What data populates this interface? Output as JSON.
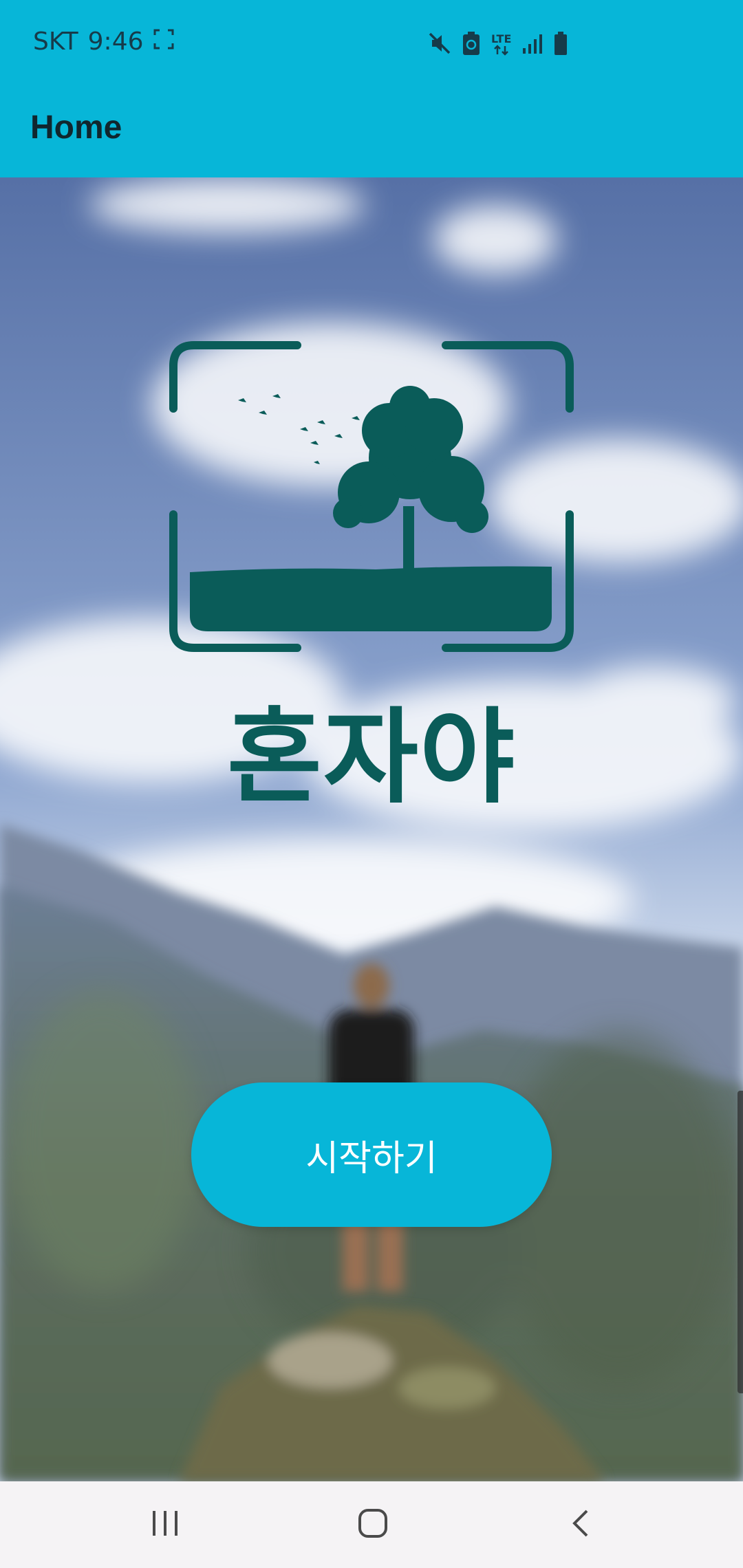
{
  "status_bar": {
    "carrier": "SKT",
    "time": "9:46",
    "network": "LTE",
    "icons": [
      "screenshot-frame-icon",
      "mute-icon",
      "battery-saver-icon",
      "lte-data-icon",
      "signal-icon",
      "battery-icon"
    ]
  },
  "app_bar": {
    "title": "Home"
  },
  "logo": {
    "text": "혼자야",
    "color": "#0a5c59"
  },
  "start_button": {
    "label": "시작하기",
    "color": "#07b6d8"
  },
  "nav_bar": {
    "buttons": [
      "recent-apps-icon",
      "home-icon",
      "back-icon"
    ]
  },
  "colors": {
    "accent": "#07b6d8",
    "nav_background": "#f5f3f5"
  }
}
